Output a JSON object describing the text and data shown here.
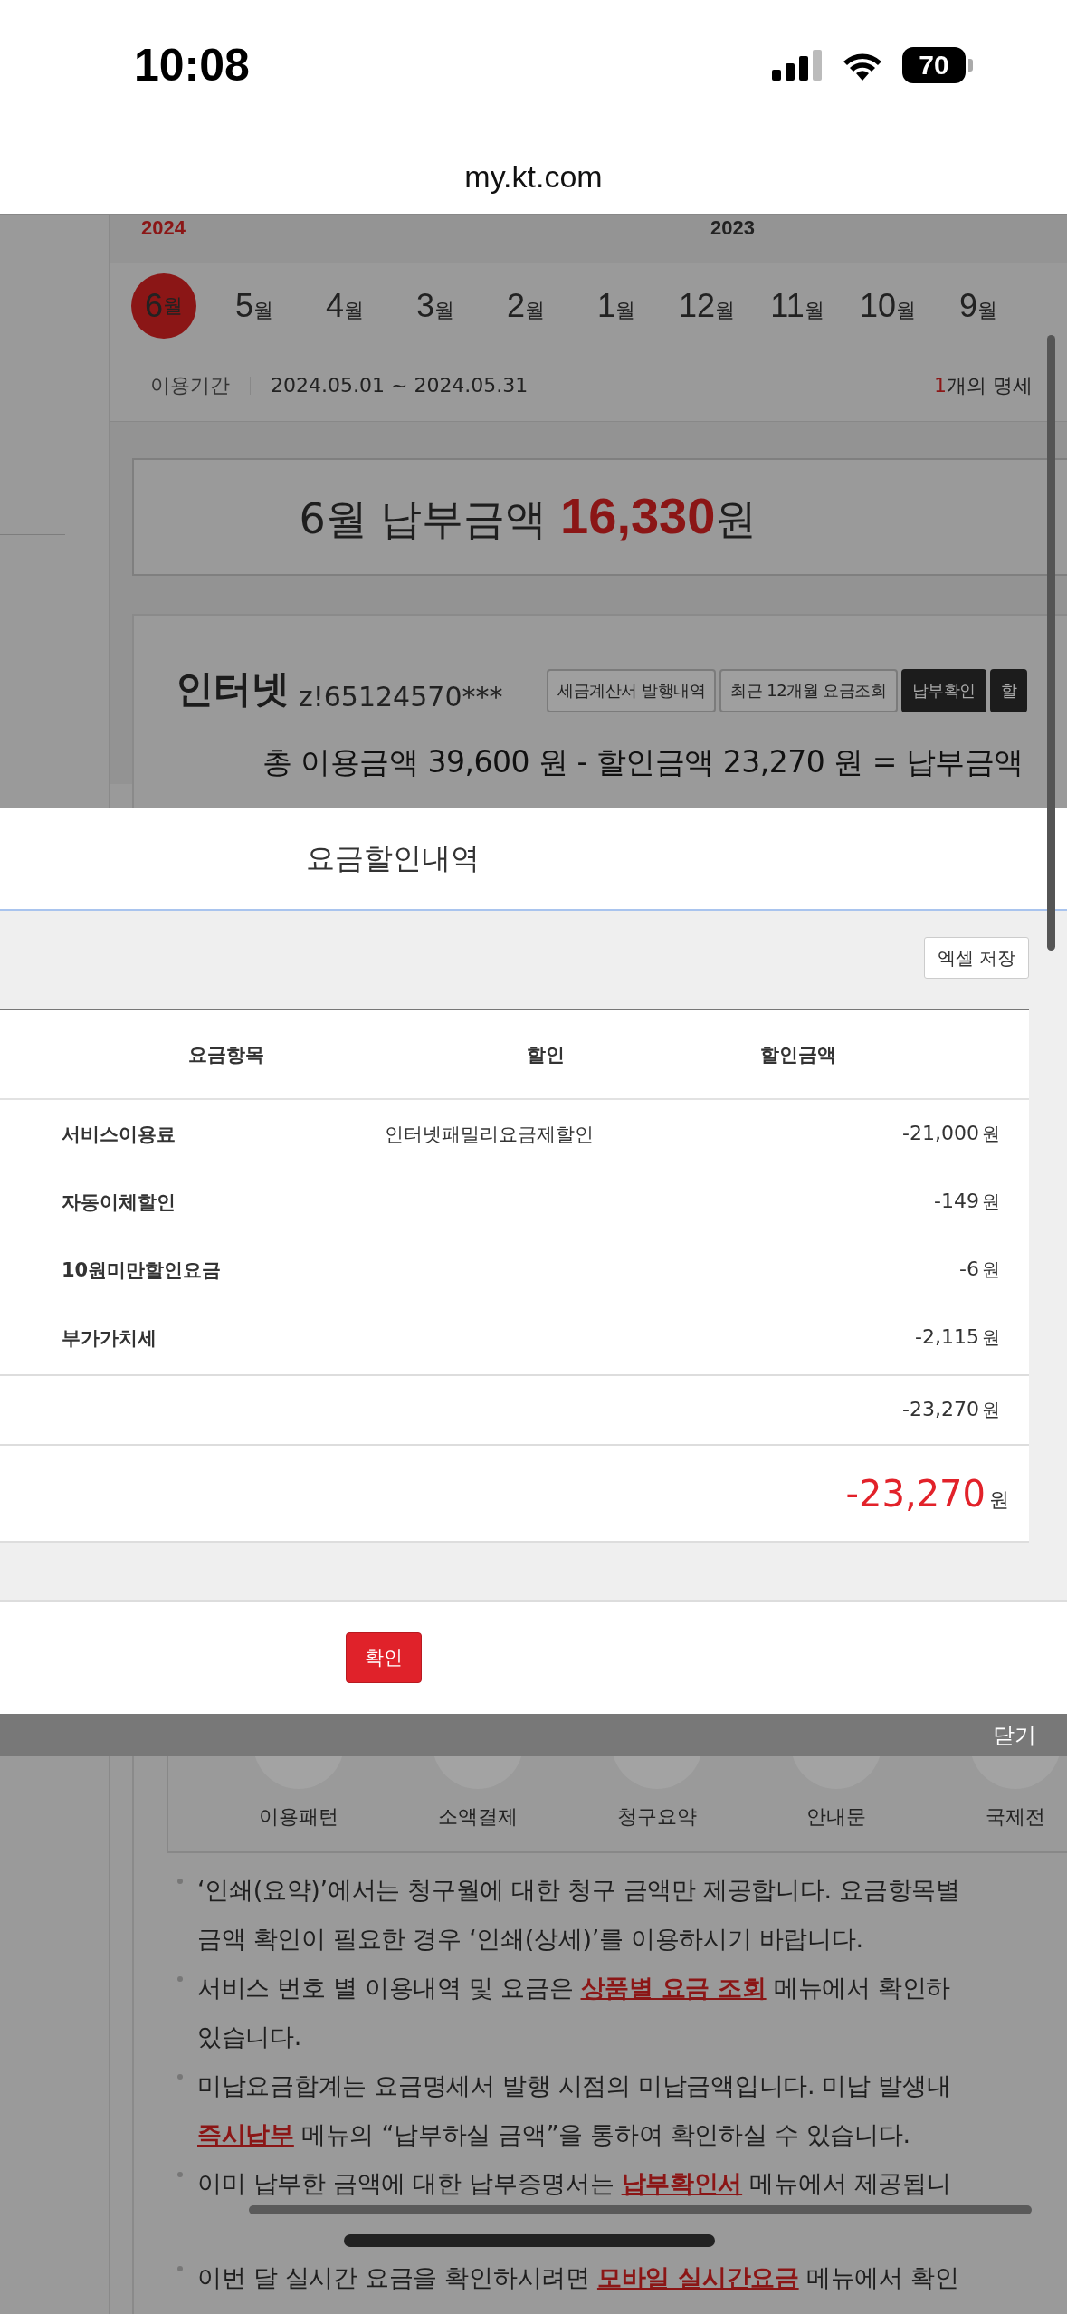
{
  "status_bar": {
    "time": "10:08",
    "battery": "70"
  },
  "address_bar": {
    "url": "my.kt.com"
  },
  "years": [
    {
      "label": "2024",
      "selected": true
    },
    {
      "label": "2023",
      "selected": false
    }
  ],
  "months": [
    {
      "number": "6",
      "unit": "월",
      "selected": true
    },
    {
      "number": "5",
      "unit": "월",
      "selected": false
    },
    {
      "number": "4",
      "unit": "월",
      "selected": false
    },
    {
      "number": "3",
      "unit": "월",
      "selected": false
    },
    {
      "number": "2",
      "unit": "월",
      "selected": false
    },
    {
      "number": "1",
      "unit": "월",
      "selected": false
    },
    {
      "number": "12",
      "unit": "월",
      "selected": false
    },
    {
      "number": "11",
      "unit": "월",
      "selected": false
    },
    {
      "number": "10",
      "unit": "월",
      "selected": false
    },
    {
      "number": "9",
      "unit": "월",
      "selected": false
    }
  ],
  "period": {
    "label": "이용기간",
    "range": "2024.05.01 ~ 2024.05.31",
    "count": "1",
    "count_suffix": "개의 명세"
  },
  "amount_banner": {
    "prefix": "6월 납부금액",
    "amount": "16,330",
    "unit": "원"
  },
  "service_card": {
    "name": "인터넷",
    "account": "z!65124570***",
    "summary": "총 이용금액 39,600 원 - 할인금액 23,270 원 = 납부금액",
    "buttons": [
      {
        "label": "세금계산서 발행내역",
        "kind": "outline"
      },
      {
        "label": "최근 12개월 요금조회",
        "kind": "outline"
      },
      {
        "label": "납부확인",
        "kind": "dark"
      },
      {
        "label": "할",
        "kind": "dark"
      }
    ]
  },
  "modal": {
    "title": "요금할인내역",
    "excel_button": "엑셀 저장",
    "columns": [
      "요금항목",
      "할인",
      "할인금액"
    ],
    "rows": [
      {
        "item": "서비스이용료",
        "discount": "인터넷패밀리요금제할인",
        "amount": "-21,000",
        "unit": "원"
      },
      {
        "item": "자동이체할인",
        "amount": "-149",
        "unit": "원"
      },
      {
        "item": "10원미만할인요금",
        "amount": "-6",
        "unit": "원"
      },
      {
        "item": "부가가치세",
        "amount": "-2,115",
        "unit": "원"
      }
    ],
    "subtotal": {
      "amount": "-23,270",
      "unit": "원"
    },
    "total": {
      "amount": "-23,270",
      "unit": "원"
    },
    "confirm_button": "확인"
  },
  "close_bar": {
    "label": "닫기"
  },
  "quick_menu": [
    {
      "label": "이용패턴"
    },
    {
      "label": "소액결제"
    },
    {
      "label": "청구요약"
    },
    {
      "label": "안내문"
    },
    {
      "label": "국제전"
    }
  ],
  "notices": [
    {
      "lines": [
        [
          {
            "kind": "text",
            "text": "‘인쇄(요약)’에서는 청구월에 대한 청구 금액만 제공합니다. 요금항목별"
          }
        ],
        [
          {
            "kind": "text",
            "text": "금액 확인이 필요한 경우 ‘인쇄(상세)’를 이용하시기 바랍니다."
          }
        ]
      ]
    },
    {
      "lines": [
        [
          {
            "kind": "text",
            "text": "서비스 번호 별 이용내역 및 요금은 "
          },
          {
            "kind": "link",
            "text": "상품별 요금 조회"
          },
          {
            "kind": "text",
            "text": " 메뉴에서 확인하"
          }
        ],
        [
          {
            "kind": "text",
            "text": "있습니다."
          }
        ]
      ]
    },
    {
      "lines": [
        [
          {
            "kind": "text",
            "text": "미납요금합계는 요금명세서 발행 시점의 미납금액입니다. 미납 발생내"
          }
        ],
        [
          {
            "kind": "link",
            "text": "즉시납부"
          },
          {
            "kind": "text",
            "text": " 메뉴의 “납부하실 금액”을 통하여 확인하실 수 있습니다."
          }
        ]
      ]
    },
    {
      "lines": [
        [
          {
            "kind": "text",
            "text": "이미 납부한 금액에 대한 납부증명서는 "
          },
          {
            "kind": "link",
            "text": "납부확인서"
          },
          {
            "kind": "text",
            "text": " 메뉴에서 제공됩니"
          }
        ]
      ]
    },
    {
      "lines": [
        [
          {
            "kind": "text",
            "text": "이번 달 실시간 요금을 확인하시려면 "
          },
          {
            "kind": "link",
            "text": "모바일 실시간요금"
          },
          {
            "kind": "text",
            "text": " 메뉴에서 확인"
          }
        ]
      ]
    }
  ]
}
